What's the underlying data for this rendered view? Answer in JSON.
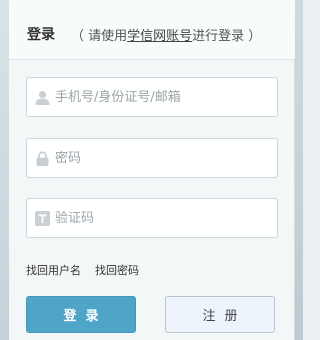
{
  "header": {
    "title": "登录",
    "hint_prefix": "（ 请使用",
    "hint_link": "学信网账号",
    "hint_suffix": "进行登录 ）"
  },
  "fields": {
    "account": {
      "placeholder": "手机号/身份证号/邮箱",
      "icon": "user-icon"
    },
    "password": {
      "placeholder": "密码",
      "icon": "lock-icon"
    },
    "captcha": {
      "placeholder": "验证码",
      "icon": "captcha-t-icon"
    }
  },
  "links": {
    "recover_username": "找回用户名",
    "recover_password": "找回密码"
  },
  "buttons": {
    "login": "登录",
    "register": "注册"
  },
  "colors": {
    "primary": "#4ea5c7",
    "secondary_bg": "#eef4fb",
    "icon_gray": "#c9d0d4"
  }
}
